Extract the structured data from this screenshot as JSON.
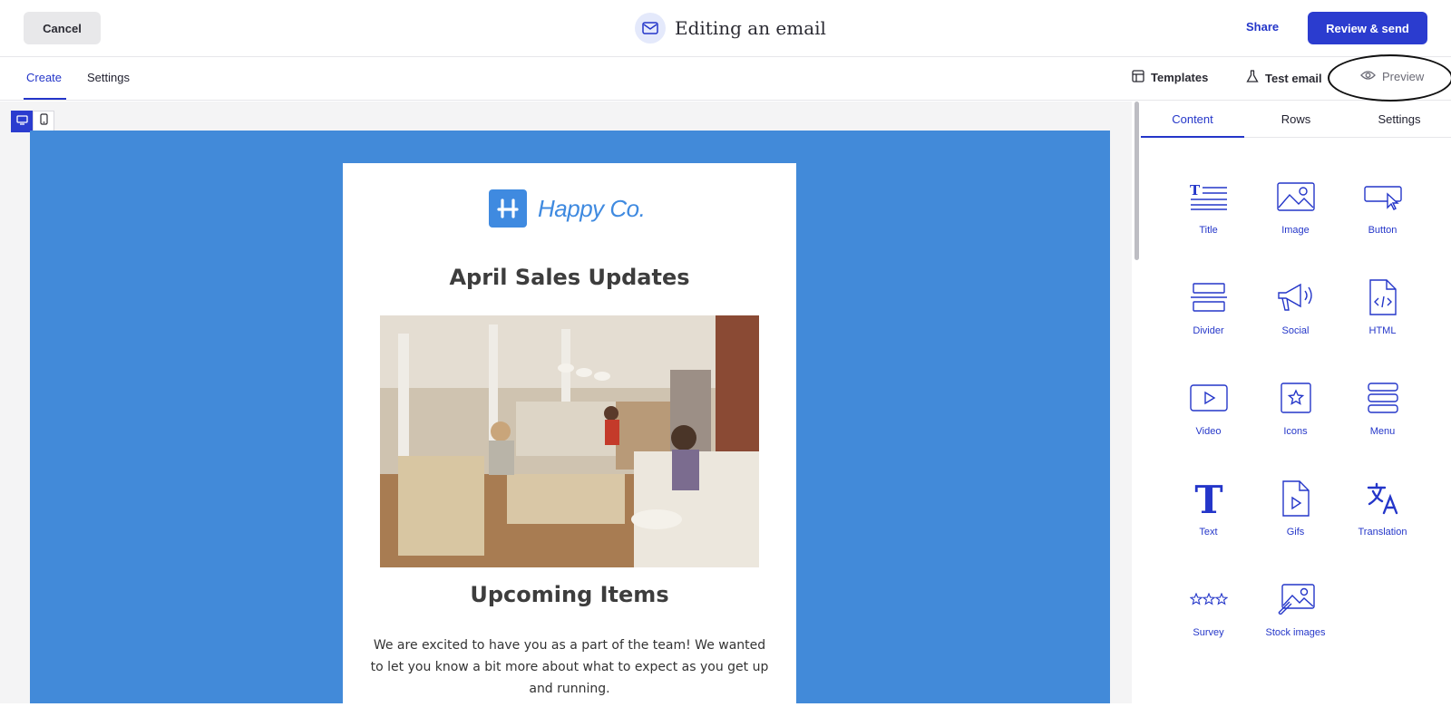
{
  "header": {
    "cancel_label": "Cancel",
    "title": "Editing an email",
    "share_label": "Share",
    "review_label": "Review & send"
  },
  "subnav": {
    "tabs": [
      {
        "label": "Create",
        "active": true
      },
      {
        "label": "Settings",
        "active": false
      }
    ],
    "tools": {
      "templates": "Templates",
      "test_email": "Test email",
      "preview": "Preview"
    }
  },
  "email": {
    "brand": "Happy Co.",
    "heading": "April Sales Updates",
    "subheading": "Upcoming Items",
    "body": "We are excited to have you as a part of the team! We wanted to let you know a bit more about what to expect as you get up and running."
  },
  "panel": {
    "tabs": [
      {
        "label": "Content",
        "active": true
      },
      {
        "label": "Rows",
        "active": false
      },
      {
        "label": "Settings",
        "active": false
      }
    ],
    "blocks": [
      {
        "label": "Title",
        "icon": "title-icon"
      },
      {
        "label": "Image",
        "icon": "image-icon"
      },
      {
        "label": "Button",
        "icon": "button-icon"
      },
      {
        "label": "Divider",
        "icon": "divider-icon"
      },
      {
        "label": "Social",
        "icon": "megaphone-icon"
      },
      {
        "label": "HTML",
        "icon": "html-file-icon"
      },
      {
        "label": "Video",
        "icon": "video-icon"
      },
      {
        "label": "Icons",
        "icon": "star-box-icon"
      },
      {
        "label": "Menu",
        "icon": "menu-icon"
      },
      {
        "label": "Text",
        "icon": "text-icon"
      },
      {
        "label": "Gifs",
        "icon": "gif-file-icon"
      },
      {
        "label": "Translation",
        "icon": "translation-icon"
      },
      {
        "label": "Survey",
        "icon": "stars-icon"
      },
      {
        "label": "Stock images",
        "icon": "stock-images-icon"
      }
    ]
  },
  "colors": {
    "accent": "#2b3ccf",
    "email_background": "#428ad9",
    "brand": "#3f8ae0"
  }
}
